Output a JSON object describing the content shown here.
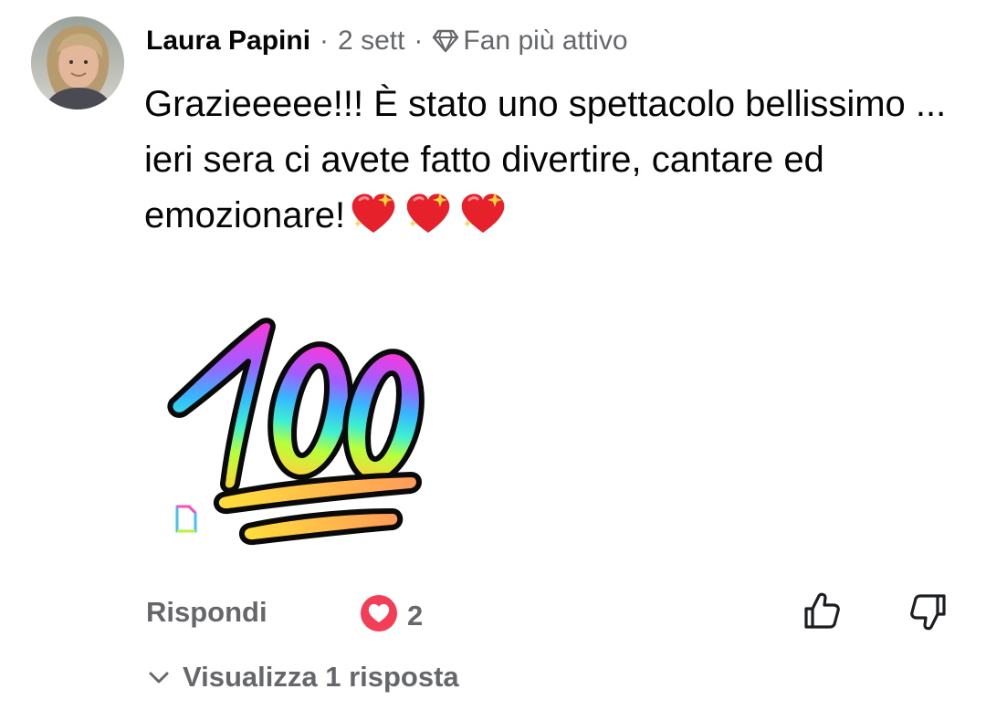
{
  "comment": {
    "author": "Laura Papini",
    "time": "2 sett",
    "separator": "·",
    "badge_label": "Fan più attivo",
    "text": "Grazieeeee!!! È stato uno spettacolo bellissimo ... ieri sera ci avete fatto divertire, cantare ed emozionare!",
    "emojis": [
      "sparkling-heart",
      "sparkling-heart",
      "sparkling-heart"
    ],
    "sticker": "100"
  },
  "actions": {
    "reply_label": "Rispondi",
    "reaction_type": "love",
    "reaction_count": "2",
    "reaction_color": "#f33e58",
    "view_replies_label": "Visualizza 1 risposta"
  },
  "colors": {
    "primary_text": "#050505",
    "secondary_text": "#65676b",
    "background": "#ffffff"
  }
}
